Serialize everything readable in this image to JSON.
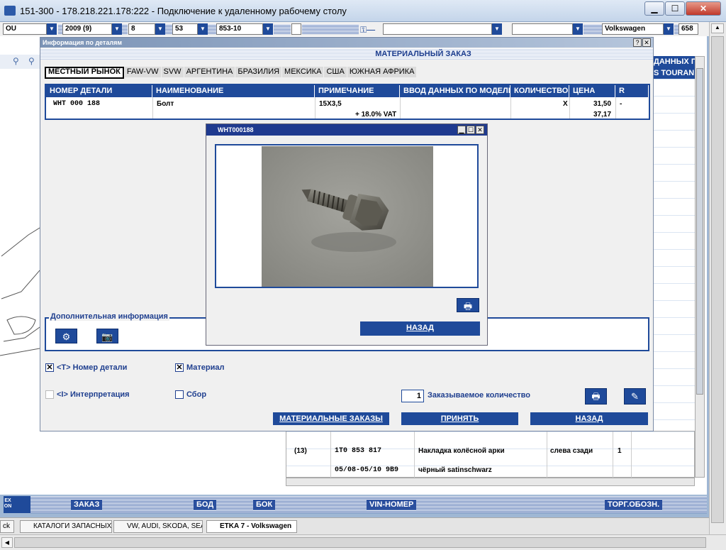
{
  "window": {
    "title": "151-300 - 178.218.221.178:222 - Подключение к удаленному рабочему столу",
    "min": "▁",
    "max": "☐",
    "close": "✕"
  },
  "toolbar": {
    "combo1": "OU",
    "combo2": "2009 (9)",
    "combo3": "8",
    "combo4": "53",
    "combo5": "853-10",
    "brand": "Volkswagen",
    "number": "658"
  },
  "bg": {
    "header_right_1": "ДАННЫХ П",
    "header_right_2": "S TOURAN",
    "row1": {
      "num": "(13)",
      "part": "1T0 853 817",
      "name": "Накладка колёсной арки",
      "note": "слева сзади",
      "qty": "1"
    },
    "row2": {
      "num": "",
      "part": "05/08-05/10 9B9",
      "name": "чёрный satinschwarz"
    }
  },
  "dialog": {
    "title": "Информация по деталям",
    "header": "МАТЕРИАЛЬНЫЙ ЗАКАЗ",
    "help": "?",
    "close": "✕",
    "tabs": [
      "МЕСТНЫЙ РЫНОК",
      "FAW-VW",
      "SVW",
      "АРГЕНТИНА",
      "БРАЗИЛИЯ",
      "МЕКСИКА",
      "США",
      "ЮЖНАЯ АФРИКА"
    ],
    "columns": [
      "НОМЕР ДЕТАЛИ",
      "НАИМЕНОВАНИЕ",
      "ПРИМЕЧАНИЕ",
      "ВВОД ДАННЫХ ПО МОДЕЛИ",
      "КОЛИЧЕСТВО",
      "ЦЕНА",
      "R"
    ],
    "row": {
      "part": "WHT 000 188",
      "name": "Болт",
      "note": "15X3,5",
      "vat": "+ 18.0% VAT",
      "qty": "X",
      "price1": "31,50",
      "price2": "37,17",
      "r": "-"
    },
    "info_legend": "Дополнительная информация",
    "chk_part": "<T> Номер детали",
    "chk_material": "Материал",
    "chk_interp": "<I> Интерпретация",
    "chk_assembly": "Сбор",
    "qty_value": "1",
    "qty_label": "Заказываемое количество",
    "btn_material_orders": "МАТЕРИАЛЬНЫЕ ЗАКАЗЫ",
    "btn_accept": "ПРИНЯТЬ",
    "btn_back": "НАЗАД"
  },
  "popup": {
    "title": "WHT000188",
    "back": "НАЗАД"
  },
  "bottombar": {
    "logo": "EX\nON",
    "order": "ЗАКАЗ",
    "bod": "БОД",
    "bok": "БОК",
    "vin": "VIN-НОМЕР",
    "trade": "ТОРГ.ОБОЗН."
  },
  "taskbar": [
    "КАТАЛОГИ ЗАПАСНЫХ ...",
    "VW, AUDI, SKODA, SEAT",
    "ETKA 7 - Volkswagen"
  ],
  "taskbar_left": "ck"
}
